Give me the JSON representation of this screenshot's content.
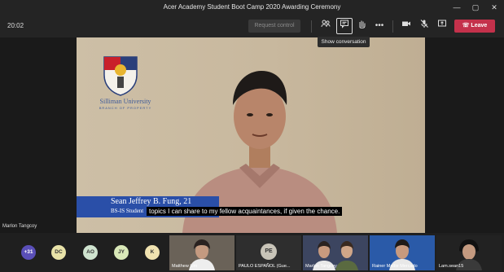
{
  "window": {
    "title": "Acer Academy Student Boot Camp 2020 Awarding Ceremony",
    "minimize": "—",
    "maximize": "▢",
    "close": "✕"
  },
  "toolbar": {
    "timer": "20:02",
    "request_control": "Request control",
    "show_conversation_tooltip": "Show conversation",
    "leave_label": "Leave",
    "more_label": "•••"
  },
  "video": {
    "university_name": "Silliman University",
    "university_sub": "BRANCH OF PROPERTY",
    "lower_third_name": "Sean Jeffrey B. Fung, 21",
    "lower_third_sub": "BS-IS Student",
    "caption": "topics I can share to my fellow acquaintances, if given the chance.",
    "speaker_label": "Marlon Tangcoy"
  },
  "participants": {
    "overflow_count": "+31",
    "avatars": [
      {
        "initials": "DC",
        "color": "#e8e2a8"
      },
      {
        "initials": "AO",
        "color": "#cfe3cf"
      },
      {
        "initials": "JY",
        "color": "#d9e8b8"
      },
      {
        "initials": "K",
        "color": "#f0e2b0"
      }
    ],
    "tiles": [
      {
        "name": "Matthew Lim"
      },
      {
        "name": "PAULO ESPAÑOL (Gue...",
        "initials": "PE"
      },
      {
        "name": "Marlon Tangcoy"
      },
      {
        "name": "Rainer Mattie Mercado"
      },
      {
        "name": "Lam.sean15"
      }
    ]
  }
}
